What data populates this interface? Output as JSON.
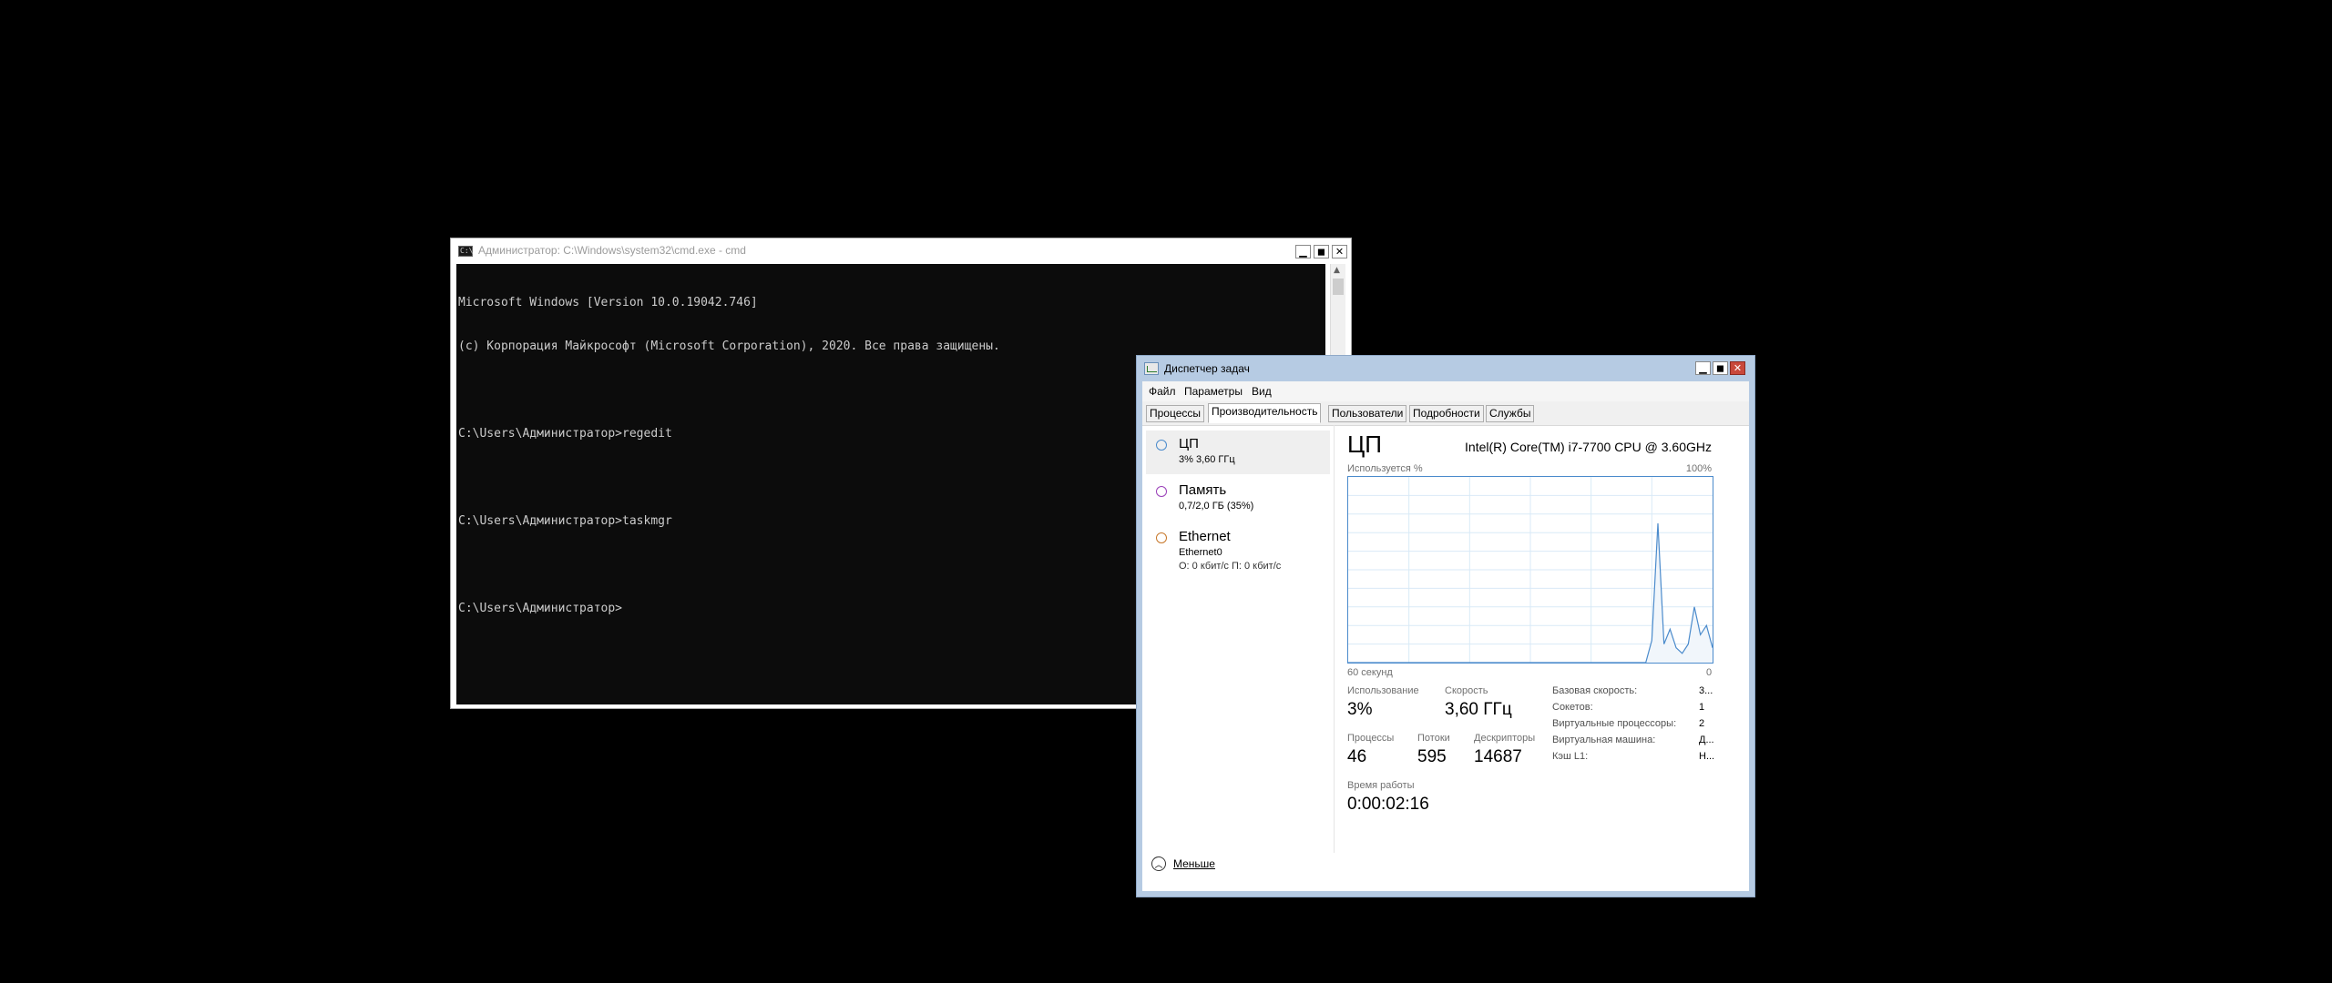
{
  "cmd": {
    "title": "Администратор: C:\\Windows\\system32\\cmd.exe - cmd",
    "icon_text": "C:\\",
    "lines": [
      "Microsoft Windows [Version 10.0.19042.746]",
      "(c) Корпорация Майкрософт (Microsoft Corporation), 2020. Все права защищены.",
      "",
      "C:\\Users\\Администратор>regedit",
      "",
      "C:\\Users\\Администратор>taskmgr",
      "",
      "C:\\Users\\Администратор>"
    ]
  },
  "taskmgr": {
    "title": "Диспетчер задач",
    "menu": [
      "Файл",
      "Параметры",
      "Вид"
    ],
    "tabs": [
      "Процессы",
      "Производительность",
      "Пользователи",
      "Подробности",
      "Службы"
    ],
    "active_tab": 1,
    "sidebar": [
      {
        "name": "ЦП",
        "sub": "3% 3,60 ГГц",
        "color": "#4b8bcc"
      },
      {
        "name": "Память",
        "sub": "0,7/2,0 ГБ (35%)",
        "color": "#9a3fb8"
      },
      {
        "name": "Ethernet",
        "sub": "Ethernet0",
        "sub2": "О: 0 кбит/с П: 0 кбит/с",
        "color": "#c7772a"
      }
    ],
    "cpu": {
      "heading": "ЦП",
      "model": "Intel(R) Core(TM) i7-7700 CPU @ 3.60GHz",
      "graph_label": "Используется %",
      "graph_max": "100%",
      "graph_time": "60 секунд",
      "graph_zero": "0",
      "usage_label": "Использование",
      "usage_value": "3%",
      "speed_label": "Скорость",
      "speed_value": "3,60 ГГц",
      "processes_label": "Процессы",
      "processes_value": "46",
      "threads_label": "Потоки",
      "threads_value": "595",
      "handles_label": "Дескрипторы",
      "handles_value": "14687",
      "uptime_label": "Время работы",
      "uptime_value": "0:00:02:16",
      "details": [
        {
          "key": "Базовая скорость:",
          "value": "3..."
        },
        {
          "key": "Сокетов:",
          "value": "1"
        },
        {
          "key": "Виртуальные процессоры:",
          "value": "2"
        },
        {
          "key": "Виртуальная машина:",
          "value": "Д..."
        },
        {
          "key": "Кэш L1:",
          "value": "Н..."
        }
      ]
    },
    "footer_label": "Меньше"
  },
  "chart_data": {
    "type": "area",
    "title": "",
    "xlabel": "60 секунд",
    "ylabel": "Используется %",
    "xlim": [
      60,
      0
    ],
    "ylim": [
      0,
      100
    ],
    "grid": true,
    "x": [
      60,
      59,
      58,
      57,
      56,
      55,
      54,
      53,
      52,
      51,
      50,
      49,
      48,
      47,
      46,
      45,
      44,
      43,
      42,
      41,
      40,
      39,
      38,
      37,
      36,
      35,
      34,
      33,
      32,
      31,
      30,
      29,
      28,
      27,
      26,
      25,
      24,
      23,
      22,
      21,
      20,
      19,
      18,
      17,
      16,
      15,
      14,
      13,
      12,
      11,
      10,
      9,
      8,
      7,
      6,
      5,
      4,
      3,
      2,
      1,
      0
    ],
    "series": [
      {
        "values": [
          0,
          0,
          0,
          0,
          0,
          0,
          0,
          0,
          0,
          0,
          0,
          0,
          0,
          0,
          0,
          0,
          0,
          0,
          0,
          0,
          0,
          0,
          0,
          0,
          0,
          0,
          0,
          0,
          0,
          0,
          0,
          0,
          0,
          0,
          0,
          0,
          0,
          0,
          0,
          0,
          0,
          0,
          0,
          0,
          0,
          0,
          0,
          0,
          0,
          0,
          12,
          75,
          10,
          18,
          8,
          5,
          10,
          30,
          15,
          20,
          8
        ]
      }
    ]
  }
}
